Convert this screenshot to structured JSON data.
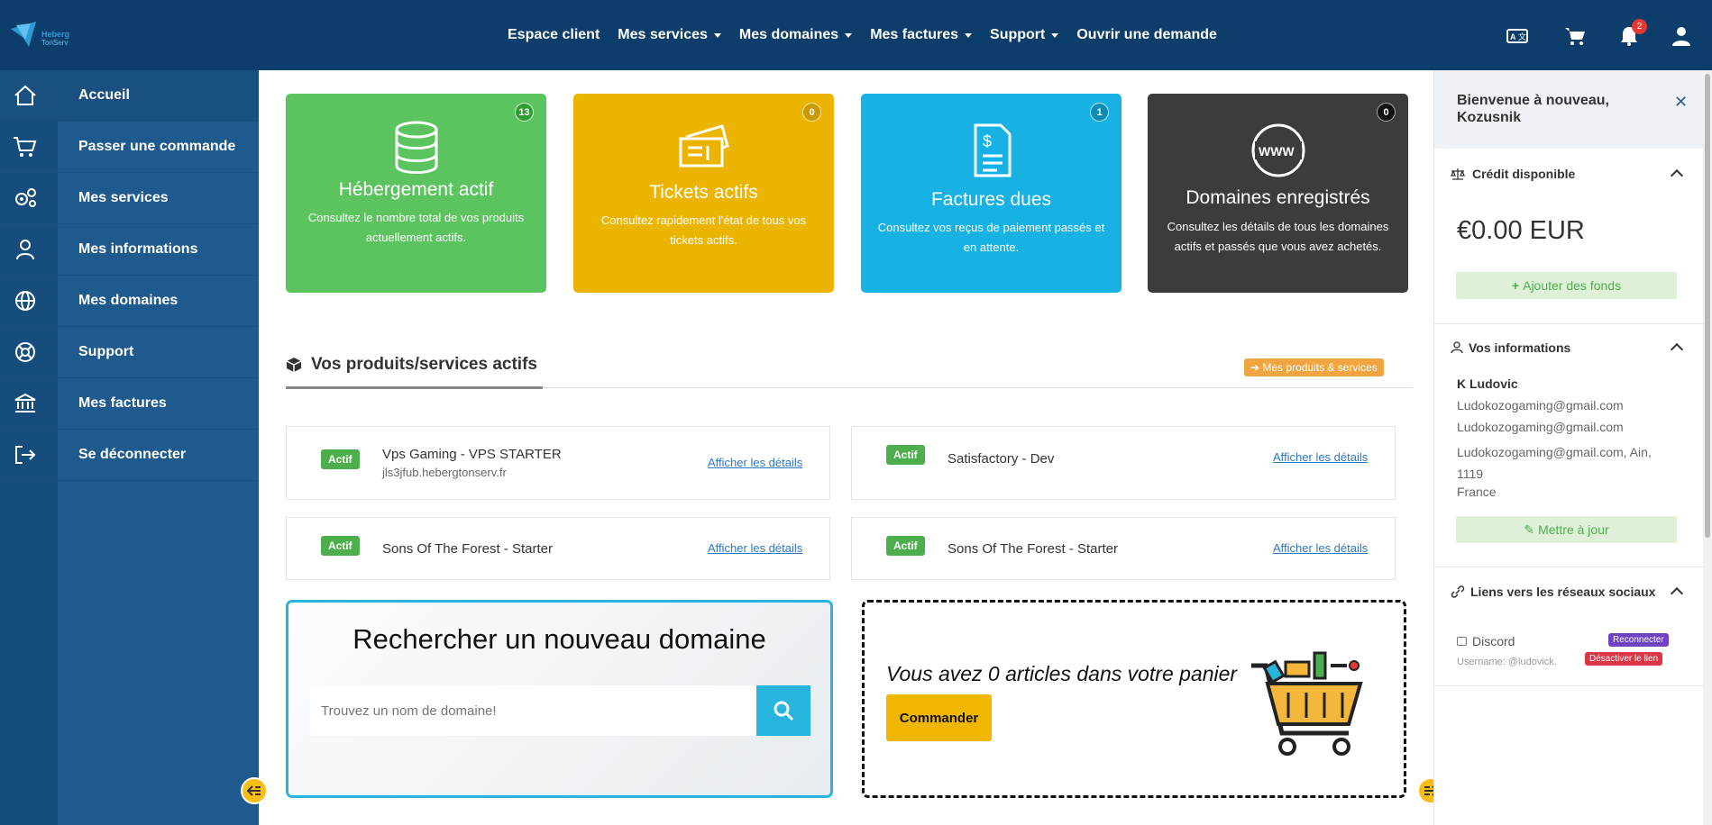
{
  "topnav": {
    "items": [
      {
        "label": "Espace client",
        "caret": false
      },
      {
        "label": "Mes services",
        "caret": true
      },
      {
        "label": "Mes domaines",
        "caret": true
      },
      {
        "label": "Mes factures",
        "caret": true
      },
      {
        "label": "Support",
        "caret": true
      },
      {
        "label": "Ouvrir une demande",
        "caret": false
      }
    ],
    "icons": [
      "translate-icon",
      "cart-icon",
      "bell-icon",
      "user-icon"
    ],
    "notification_count": "2"
  },
  "sidebar": {
    "items": [
      {
        "label": "Accueil",
        "icon": "home-icon"
      },
      {
        "label": "Passer une commande",
        "icon": "cart-icon"
      },
      {
        "label": "Mes services",
        "icon": "gears-icon"
      },
      {
        "label": "Mes informations",
        "icon": "user-icon"
      },
      {
        "label": "Mes domaines",
        "icon": "globe-icon"
      },
      {
        "label": "Support",
        "icon": "lifebuoy-icon"
      },
      {
        "label": "Mes factures",
        "icon": "bank-icon"
      },
      {
        "label": "Se déconnecter",
        "icon": "logout-icon"
      }
    ]
  },
  "cards": [
    {
      "title": "Hébergement actif",
      "count": "13",
      "desc": "Consultez le nombre total de vos produits actuellement actifs.",
      "color": "#5cc45f",
      "icon": "database-icon"
    },
    {
      "title": "Tickets actifs",
      "count": "0",
      "desc": "Consultez rapidement l'état de tous vos tickets actifs.",
      "color": "#ebb400",
      "icon": "tickets-icon"
    },
    {
      "title": "Factures dues",
      "count": "1",
      "desc": "Consultez vos reçus de paiement passés et en attente.",
      "color": "#17b1e3",
      "icon": "invoice-icon"
    },
    {
      "title": "Domaines enregistrés",
      "count": "0",
      "desc": "Consultez les détails de tous les domaines actifs et passés que vous avez achetés.",
      "color": "#3c3c3c",
      "icon": "www-icon"
    }
  ],
  "products": {
    "title": "Vos produits/services actifs",
    "button": "Mes produits & services",
    "items": [
      {
        "status": "Actif",
        "name": "Vps Gaming - VPS STARTER",
        "sub": "jls3jfub.hebergtonserv.fr",
        "link": "Afficher les détails"
      },
      {
        "status": "Actif",
        "name": "Satisfactory - Dev",
        "sub": "",
        "link": "Afficher les détails"
      },
      {
        "status": "Actif",
        "name": "Sons Of The Forest - Starter",
        "sub": "",
        "link": "Afficher les détails"
      },
      {
        "status": "Actif",
        "name": "Sons Of The Forest - Starter",
        "sub": "",
        "link": "Afficher les détails"
      }
    ]
  },
  "domain_search": {
    "title": "Rechercher un nouveau domaine",
    "placeholder": "Trouvez un nom de domaine!"
  },
  "cart": {
    "text": "Vous avez 0 articles dans votre panier",
    "button": "Commander"
  },
  "right": {
    "welcome": "Bienvenue à nouveau, Kozusnik",
    "credit_title": "Crédit disponible",
    "credit_value": "€0.00 EUR",
    "add_funds": "Ajouter des fonds",
    "info_title": "Vos informations",
    "name": "K Ludovic",
    "email1": "Ludokozogaming@gmail.com",
    "email2": "Ludokozogaming@gmail.com",
    "address": "Ludokozogaming@gmail.com, Ain, 1119",
    "country": "France",
    "update": "Mettre à jour",
    "social_title": "Liens vers les réseaux sociaux",
    "discord": "Discord",
    "discord_user": "Username: @ludovick.",
    "reconnect": "Reconnecter",
    "unlink": "Désactiver le lien"
  },
  "colors": {
    "topbar": "#0d3d6b",
    "sidebar": "#1e5a8e",
    "accent": "#28b5dd",
    "fab": "#fcbd12"
  }
}
